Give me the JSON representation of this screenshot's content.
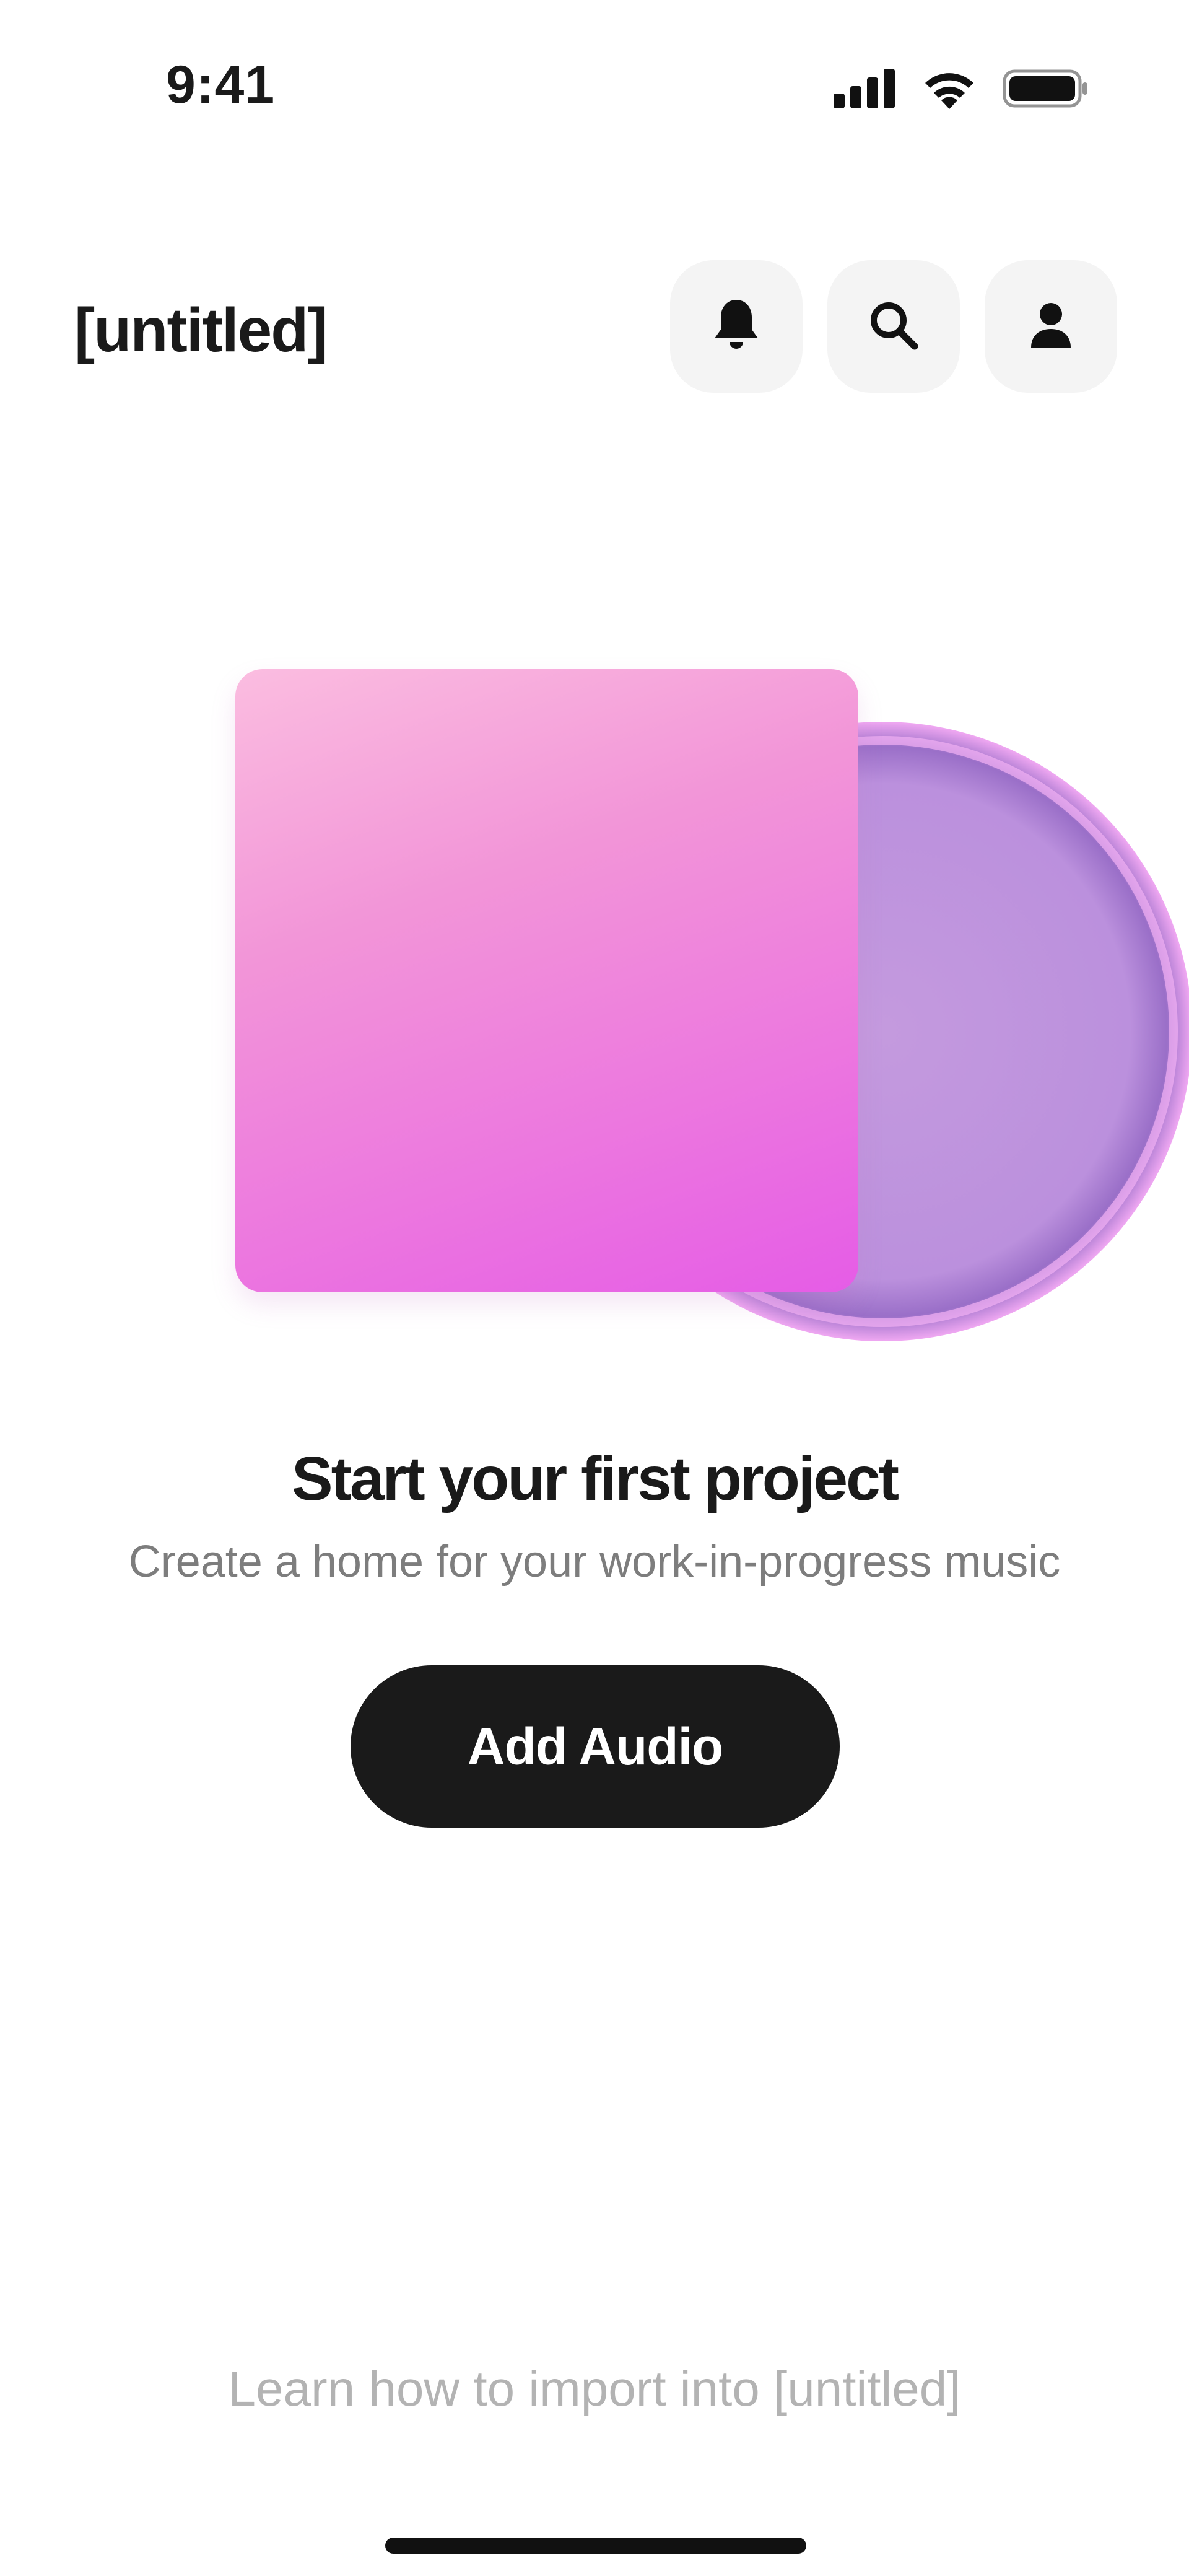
{
  "status_bar": {
    "time": "9:41",
    "icons": [
      "cellular-signal-icon",
      "wifi-icon",
      "battery-icon"
    ]
  },
  "header": {
    "title": "[untitled]",
    "buttons": [
      {
        "name": "notifications",
        "icon": "bell-icon"
      },
      {
        "name": "search",
        "icon": "search-icon"
      },
      {
        "name": "profile",
        "icon": "person-icon"
      }
    ]
  },
  "empty_state": {
    "title": "Start your first project",
    "subtitle": "Create a home for your work-in-progress music",
    "button_label": "Add Audio"
  },
  "footer": {
    "learn_link": "Learn how to import into [untitled]"
  },
  "colors": {
    "background": "#ffffff",
    "primary_button": "#1a1a1a",
    "header_button_bg": "#f4f4f4",
    "subtitle_text": "#7d7d7d",
    "link_text": "#b3b3b3",
    "cover_gradient_start": "#fbbde0",
    "cover_gradient_end": "#e55ce6",
    "vinyl": "#b88ad8"
  }
}
